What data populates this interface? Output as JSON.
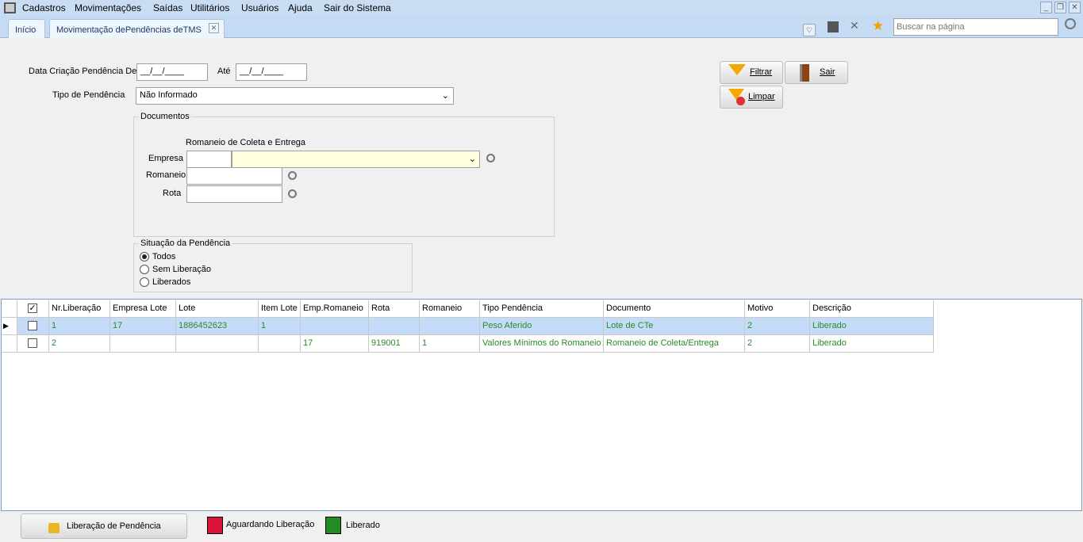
{
  "menu": {
    "items": [
      "Cadastros",
      "Movimentações",
      "Saídas",
      "Utilitários",
      "Usuários",
      "Ajuda",
      "Sair do Sistema"
    ]
  },
  "tabs": [
    {
      "label": "Início"
    },
    {
      "label": "Movimentação dePendências deTMS"
    }
  ],
  "search": {
    "placeholder": "Buscar na página"
  },
  "form": {
    "date_from_label": "Data Criação Pendência De",
    "date_from": "__/__/____",
    "date_to_label": "Até",
    "date_to": "__/__/____",
    "tipo_label": "Tipo de Pendência",
    "tipo_value": "Não Informado",
    "documentos_legend": "Documentos",
    "romaneio_section": "Romaneio de Coleta e Entrega",
    "empresa_label": "Empresa",
    "romaneio_label": "Romaneio",
    "rota_label": "Rota",
    "situacao_legend": "Situação da Pendência",
    "situacao_options": [
      {
        "label": "Todos",
        "checked": true
      },
      {
        "label": "Sem Liberação",
        "checked": false
      },
      {
        "label": "Liberados",
        "checked": false
      }
    ]
  },
  "buttons": {
    "filtrar": "Filtrar",
    "sair": "Sair",
    "limpar": "Limpar",
    "liberacao": "Liberação de Pendência"
  },
  "grid": {
    "columns": [
      "Nr.Liberação",
      "Empresa Lote",
      "Lote",
      "Item Lote",
      "Emp.Romaneio",
      "Rota",
      "Romaneio",
      "Tipo Pendência",
      "Documento",
      "Motivo",
      "Descrição"
    ],
    "header_checked": true,
    "rows": [
      {
        "selected": true,
        "checked": false,
        "cells": [
          "1",
          "17",
          "1886452623",
          "1",
          "",
          "",
          "",
          "Peso Aferido",
          "Lote de CTe",
          "2",
          "Liberado"
        ]
      },
      {
        "selected": false,
        "checked": false,
        "cells": [
          "2",
          "",
          "",
          "",
          "17",
          "919001",
          "1",
          "Valores Mínimos do Romaneio",
          "Romaneio de Coleta/Entrega",
          "2",
          "Liberado"
        ]
      }
    ]
  },
  "legend": [
    {
      "label": "Aguardando Liberação",
      "color": "#dc143c"
    },
    {
      "label": "Liberado",
      "color": "#228b22"
    }
  ],
  "colors": {
    "data_text": "#2a8a2a",
    "selected_row": "#c5dcf8"
  }
}
